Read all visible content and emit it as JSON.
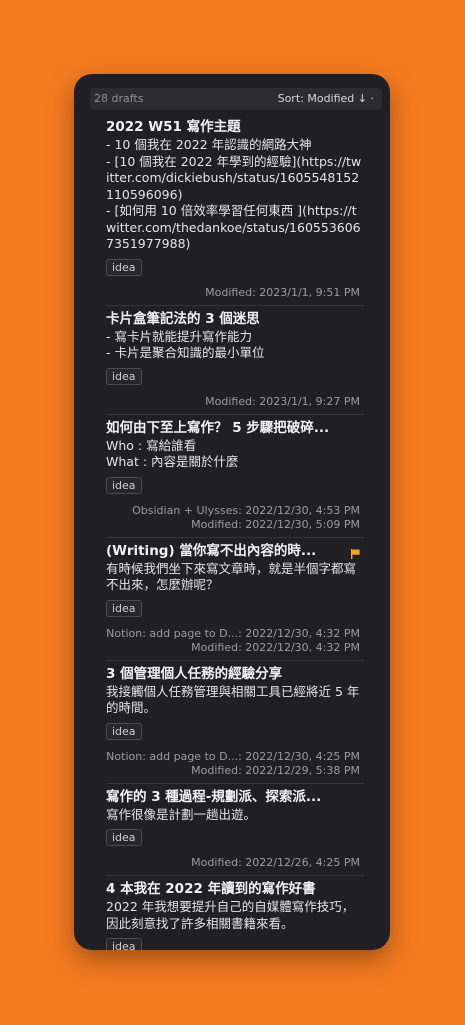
{
  "toolbar": {
    "drafts_count": "28 drafts",
    "sort_label": "Sort: Modified ↓ ·"
  },
  "drafts": [
    {
      "title": "2022 W51 寫作主題",
      "body": "- 10 個我在 2022 年認識的網路大神\n- [10 個我在 2022 年學到的經驗](https://twitter.com/dickiebush/status/1605548152110596096)\n- [如何用 10 倍效率學習任何東西 ](https://twitter.com/thedankoe/status/1605536067351977988)",
      "tag": "idea",
      "meta": [
        "Modified: 2023/1/1, 9:51 PM"
      ]
    },
    {
      "title": "卡片盒筆記法的 3 個迷思",
      "body": "- 寫卡片就能提升寫作能力\n- 卡片是聚合知識的最小單位",
      "tag": "idea",
      "meta": [
        "Modified: 2023/1/1, 9:27 PM"
      ]
    },
    {
      "title": "如何由下至上寫作？ 5 步驟把破碎...",
      "body": "Who : 寫給誰看\nWhat : 內容是關於什麼",
      "tag": "idea",
      "meta": [
        "Obsidian + Ulysses: 2022/12/30, 4:53 PM",
        "Modified: 2022/12/30, 5:09 PM"
      ]
    },
    {
      "title": "(Writing) 當你寫不出內容的時...",
      "body": "有時候我們坐下來寫文章時，就是半個字都寫不出來，怎麼辦呢？",
      "tag": "idea",
      "flag": true,
      "flag_color": "#f5a623",
      "meta": [
        "Notion: add page to D...: 2022/12/30, 4:32 PM",
        "Modified: 2022/12/30, 4:32 PM"
      ]
    },
    {
      "title": "3 個管理個人任務的經驗分享",
      "body": "我接觸個人任務管理與相關工具已經將近 5 年的時間。",
      "tag": "idea",
      "meta": [
        "Notion: add page to D...: 2022/12/30, 4:25 PM",
        "Modified: 2022/12/29, 5:38 PM"
      ]
    },
    {
      "title": "寫作的 3 種過程-規劃派、探索派...",
      "body": "寫作很像是計劃一趟出遊。",
      "tag": "idea",
      "meta": [
        "Modified: 2022/12/26, 4:25 PM"
      ]
    },
    {
      "title": "4 本我在 2022 年讀到的寫作好書",
      "body": "2022 年我想要提升自己的自媒體寫作技巧，因此刻意找了許多相關書籍來看。",
      "tag": "idea",
      "meta": []
    }
  ]
}
